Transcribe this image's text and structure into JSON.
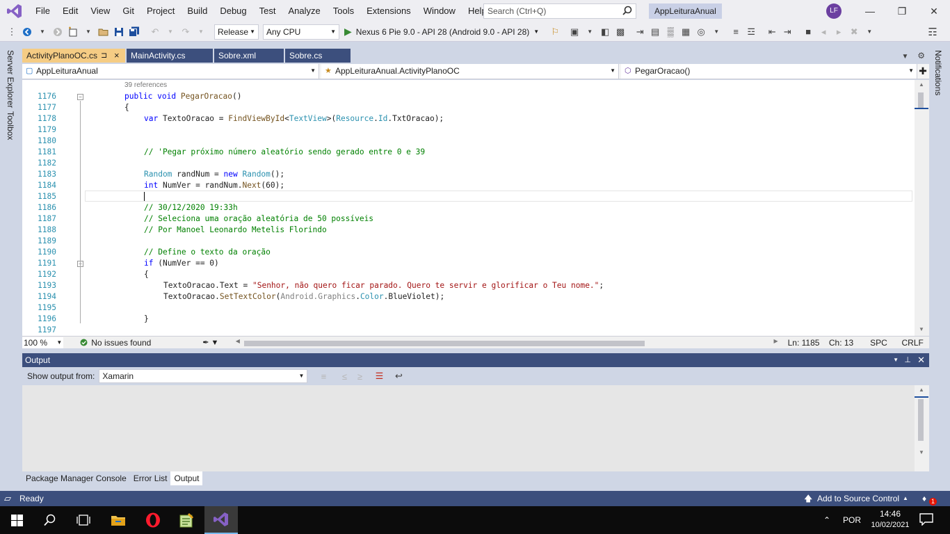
{
  "menu": {
    "items": [
      "File",
      "Edit",
      "View",
      "Git",
      "Project",
      "Build",
      "Debug",
      "Test",
      "Analyze",
      "Tools",
      "Extensions",
      "Window",
      "Help"
    ],
    "search_placeholder": "Search (Ctrl+Q)",
    "solution_name": "AppLeituraAnual",
    "avatar_initials": "LF"
  },
  "toolbar": {
    "configuration": "Release",
    "platform": "Any CPU",
    "run_target": "Nexus 6 Pie 9.0 - API 28 (Android 9.0 - API 28)"
  },
  "side": {
    "left_tabs": [
      "Server Explorer",
      "Toolbox"
    ],
    "right_tabs": [
      "Notifications"
    ]
  },
  "doc_tabs": [
    {
      "label": "ActivityPlanoOC.cs",
      "pin": "⊐",
      "close": "×"
    },
    {
      "label": "MainActivity.cs"
    },
    {
      "label": "Sobre.xml"
    },
    {
      "label": "Sobre.cs"
    }
  ],
  "nav": {
    "project": "AppLeituraAnual",
    "class": "AppLeituraAnual.ActivityPlanoOC",
    "member": "PegarOracao()"
  },
  "editor": {
    "references": "39 references",
    "line_numbers": [
      "1176",
      "1177",
      "1178",
      "1179",
      "1180",
      "1181",
      "1182",
      "1183",
      "1184",
      "1185",
      "1186",
      "1187",
      "1188",
      "1189",
      "1190",
      "1191",
      "1192",
      "1193",
      "1194",
      "1195",
      "1196",
      "1197"
    ]
  },
  "code": {
    "l1176": [
      "public",
      " ",
      "void",
      " ",
      "PegarOracao",
      "()"
    ],
    "l1177": "{",
    "l1178": [
      "var",
      " TextoOracao = ",
      "FindViewById",
      "<",
      "TextView",
      ">(",
      "Resource",
      ".",
      "Id",
      ".TxtOracao);"
    ],
    "l1181": "// 'Pegar próximo número aleatório sendo gerado entre 0 e 39",
    "l1183": [
      "Random",
      " randNum = ",
      "new",
      " ",
      "Random",
      "();"
    ],
    "l1184": [
      "int",
      " NumVer = randNum.",
      "Next",
      "(60);"
    ],
    "l1186": "// 30/12/2020 19:33h",
    "l1187": "// Seleciona uma oração aleatória de 50 possíveis",
    "l1188": "// Por Manoel Leonardo Metelis Florindo",
    "l1190": "// Define o texto da oração",
    "l1191": [
      "if",
      " (NumVer == 0)"
    ],
    "l1192": "{",
    "l1193": [
      "TextoOracao.Text = ",
      "\"Senhor, não quero ficar parado. Quero te servir e glorificar o Teu nome.\"",
      ";"
    ],
    "l1194": [
      "TextoOracao.",
      "SetTextColor",
      "(",
      "Android.Graphics",
      ".",
      "Color",
      ".BlueViolet);"
    ],
    "l1196": "}"
  },
  "editor_status": {
    "zoom": "100 %",
    "issues": "No issues found",
    "ln": "Ln: 1185",
    "ch": "Ch: 13",
    "spc": "SPC",
    "crlf": "CRLF"
  },
  "output": {
    "title": "Output",
    "show_from_label": "Show output from:",
    "show_from_value": "Xamarin"
  },
  "bottom_tabs": [
    "Package Manager Console",
    "Error List",
    "Output"
  ],
  "statusbar": {
    "ready": "Ready",
    "source_control": "Add to Source Control",
    "notification_count": "1"
  },
  "taskbar": {
    "language": "POR",
    "time": "14:46",
    "date": "10/02/2021"
  },
  "colors": {
    "accent_purple": "#6b3fa0",
    "tab_active": "#f5cc84",
    "tab_inactive": "#3c4f7d",
    "statusbar": "#3c4f7d"
  }
}
